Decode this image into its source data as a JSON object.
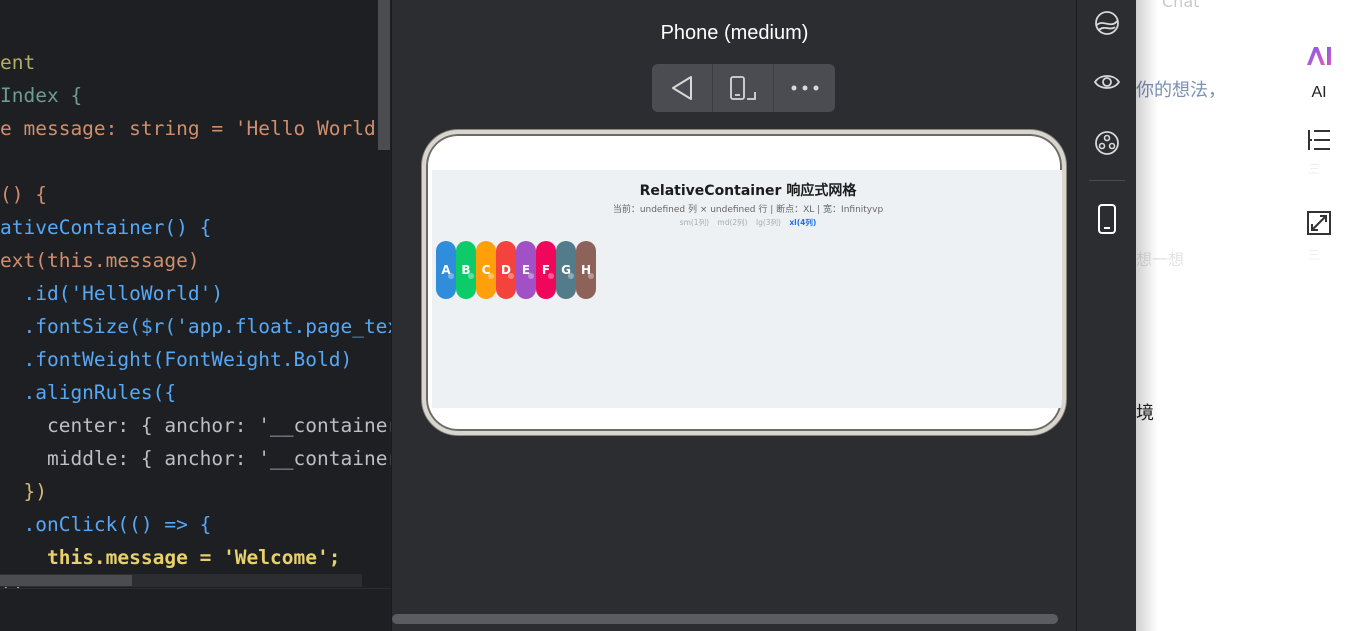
{
  "editor": {
    "lines": [
      [
        "ent"
      ],
      [
        "Index {"
      ],
      [
        "e message: string = 'Hello World'"
      ],
      [
        ""
      ],
      [
        "() {"
      ],
      [
        "ativeContainer() {"
      ],
      [
        "ext(this.message)"
      ],
      [
        ".id('HelloWorld')"
      ],
      [
        ".fontSize($r('app.float.page_tex"
      ],
      [
        ".fontWeight(FontWeight.Bold)"
      ],
      [
        ".alignRules({"
      ],
      [
        "center: { anchor: '__container"
      ],
      [
        "middle: { anchor: '__container"
      ],
      [
        "})"
      ],
      [
        ".onClick(() => {"
      ],
      [
        "this.message = 'Welcome';"
      ],
      [
        "})"
      ]
    ]
  },
  "previewer": {
    "device_title": "Phone (medium)",
    "toolbar": {
      "back_icon": "triangle-back-icon",
      "rotate_icon": "rotate-device-icon",
      "more_icon": "more-dots-icon"
    },
    "app": {
      "title": "RelativeContainer 响应式网格",
      "status": "当前：undefined 列 × undefined 行 | 断点：XL | 宽：Infinityvp",
      "breakpoints": [
        "sm(1列)",
        "md(2列)",
        "lg(3列)",
        "xl(4列)"
      ],
      "active_breakpoint": "xl(4列)",
      "items": [
        {
          "label": "A",
          "color": "#2f8ddc"
        },
        {
          "label": "B",
          "color": "#0ecb6a"
        },
        {
          "label": "C",
          "color": "#ff9f0a"
        },
        {
          "label": "D",
          "color": "#f4433c"
        },
        {
          "label": "E",
          "color": "#a150c5"
        },
        {
          "label": "F",
          "color": "#f0075c"
        },
        {
          "label": "G",
          "color": "#537c8b"
        },
        {
          "label": "H",
          "color": "#8d6259"
        }
      ]
    }
  },
  "toolstrip": {
    "icons": [
      "orbit-icon",
      "eye-icon",
      "agent-icon",
      "phone-preview-icon"
    ]
  },
  "chat": {
    "top_text": "Chat",
    "text_fragment_1": "你的想法，",
    "text_fragment_2": "想一想",
    "text_fragment_3": "境",
    "ai_label": "AI",
    "hint_1": "三",
    "hint_2": "三"
  },
  "colors": {
    "editor_bg": "#1e1f22",
    "panel_bg": "#2b2d30",
    "keyword": "#cf8e6d",
    "string": "#a07cd6",
    "function": "#56a8f5",
    "active_breakpoint": "#1a73e8"
  }
}
